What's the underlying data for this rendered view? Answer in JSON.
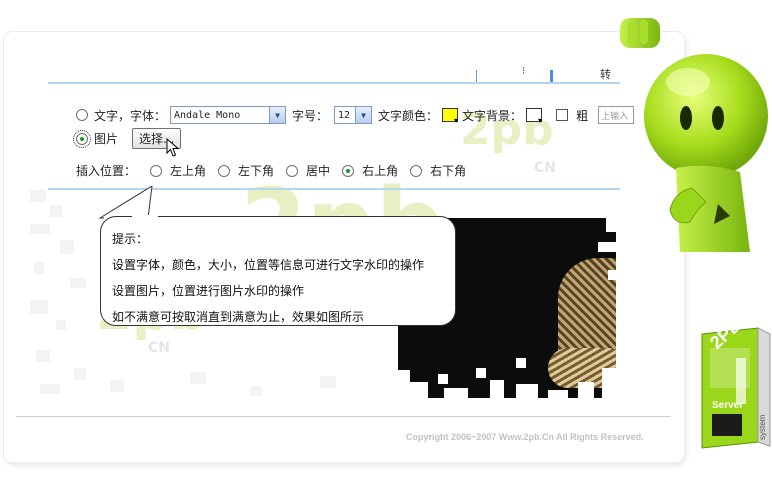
{
  "colors": {
    "accent_green": "#9ad61a",
    "toolbar_border": "#b8d4ec",
    "text_color_swatch": "#ffff00",
    "bg_color_swatch": "#ffffff"
  },
  "toolbar": {
    "text_option_label": "文字，字体：",
    "font_value": "Andale Mono",
    "font_size_label": "字号：",
    "font_size_value": "12",
    "text_color_label": "文字颜色：",
    "text_bg_label": "文字背景：",
    "bold_label": "粗",
    "extra_input_text": "上输入",
    "image_option_label": "图片",
    "choose_button": "选择...",
    "position_label": "插入位置：",
    "positions": [
      {
        "label": "左上角",
        "selected": false
      },
      {
        "label": "左下角",
        "selected": false
      },
      {
        "label": "居中",
        "selected": false
      },
      {
        "label": "右上角",
        "selected": true
      },
      {
        "label": "右下角",
        "selected": false
      }
    ],
    "selected_option": "image"
  },
  "topbar_fragments": {
    "f1": "⁝",
    "f2": "转"
  },
  "tooltip": {
    "title": "提示：",
    "lines": [
      "设置字体，颜色，大小，位置等信息可进行文字水印的操作",
      "设置图片，位置进行图片水印的操作",
      "如不满意可按取消直到满意为止，效果如图所示"
    ]
  },
  "watermark": {
    "text": "2pb",
    "suffix": "CN"
  },
  "footer": {
    "copyright": "Copyright 2006~2007 Www.2pb.Cn All Rights Reserved."
  },
  "server_box": {
    "brand": "2PB",
    "label": "Server",
    "side": "system"
  }
}
